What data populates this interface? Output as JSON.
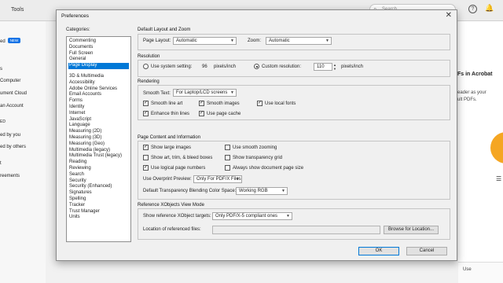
{
  "app": {
    "tools_label": "Tools",
    "search_placeholder": "Search",
    "help_icon": "?",
    "sidebar": [
      {
        "label": "ed",
        "badge": "NEW"
      },
      {
        "label": "s"
      },
      {
        "label": "Computer"
      },
      {
        "label": "ument Cloud"
      },
      {
        "label": "an Account"
      },
      {
        "label": "ED"
      },
      {
        "label": "ed by you"
      },
      {
        "label": "ed by others"
      },
      {
        "label": "t"
      },
      {
        "label": "reements"
      }
    ],
    "right_panel": {
      "title": "Fs in Acrobat",
      "line1": "eader as your",
      "line2": "ult PDFs.",
      "bottom": "Use"
    }
  },
  "dialog": {
    "title": "Preferences",
    "categories_label": "Categories:",
    "categories_top": [
      "Commenting",
      "Documents",
      "Full Screen",
      "General",
      "Page Display"
    ],
    "categories": [
      "3D & Multimedia",
      "Accessibility",
      "Adobe Online Services",
      "Email Accounts",
      "Forms",
      "Identity",
      "Internet",
      "JavaScript",
      "Language",
      "Measuring (2D)",
      "Measuring (3D)",
      "Measuring (Geo)",
      "Multimedia (legacy)",
      "Multimedia Trust (legacy)",
      "Reading",
      "Reviewing",
      "Search",
      "Security",
      "Security (Enhanced)",
      "Signatures",
      "Spelling",
      "Tracker",
      "Trust Manager",
      "Units"
    ],
    "selected_category": "Page Display",
    "layout": {
      "section": "Default Layout and Zoom",
      "page_layout_label": "Page Layout:",
      "page_layout_value": "Automatic",
      "zoom_label": "Zoom:",
      "zoom_value": "Automatic"
    },
    "resolution": {
      "section": "Resolution",
      "system_label": "Use system setting:",
      "system_value": "96",
      "system_unit": "pixels/inch",
      "custom_label": "Custom resolution:",
      "custom_value": "110",
      "custom_unit": "pixels/inch"
    },
    "rendering": {
      "section": "Rendering",
      "smooth_text_label": "Smooth Text:",
      "smooth_text_value": "For Laptop/LCD screens",
      "smooth_line_art": "Smooth line art",
      "smooth_images": "Smooth images",
      "use_local_fonts": "Use local fonts",
      "enhance_thin_lines": "Enhance thin lines",
      "use_page_cache": "Use page cache"
    },
    "page_content": {
      "section": "Page Content and Information",
      "show_large_images": "Show large images",
      "use_smooth_zooming": "Use smooth zooming",
      "show_art_trim": "Show art, trim, & bleed boxes",
      "show_transparency_grid": "Show transparency grid",
      "use_logical_page_numbers": "Use logical page numbers",
      "always_show_doc_size": "Always show document page size",
      "overprint_label": "Use Overprint Preview:",
      "overprint_value": "Only For PDF/X Files",
      "blending_label": "Default Transparency Blending Color Space:",
      "blending_value": "Working RGB"
    },
    "xobjects": {
      "section": "Reference XObjects View Mode",
      "show_targets_label": "Show reference XObject targets:",
      "show_targets_value": "Only PDF/X-5 compliant ones",
      "location_label": "Location of referenced files:",
      "location_value": "",
      "browse_label": "Browse for Location..."
    },
    "ok_label": "OK",
    "cancel_label": "Cancel"
  }
}
